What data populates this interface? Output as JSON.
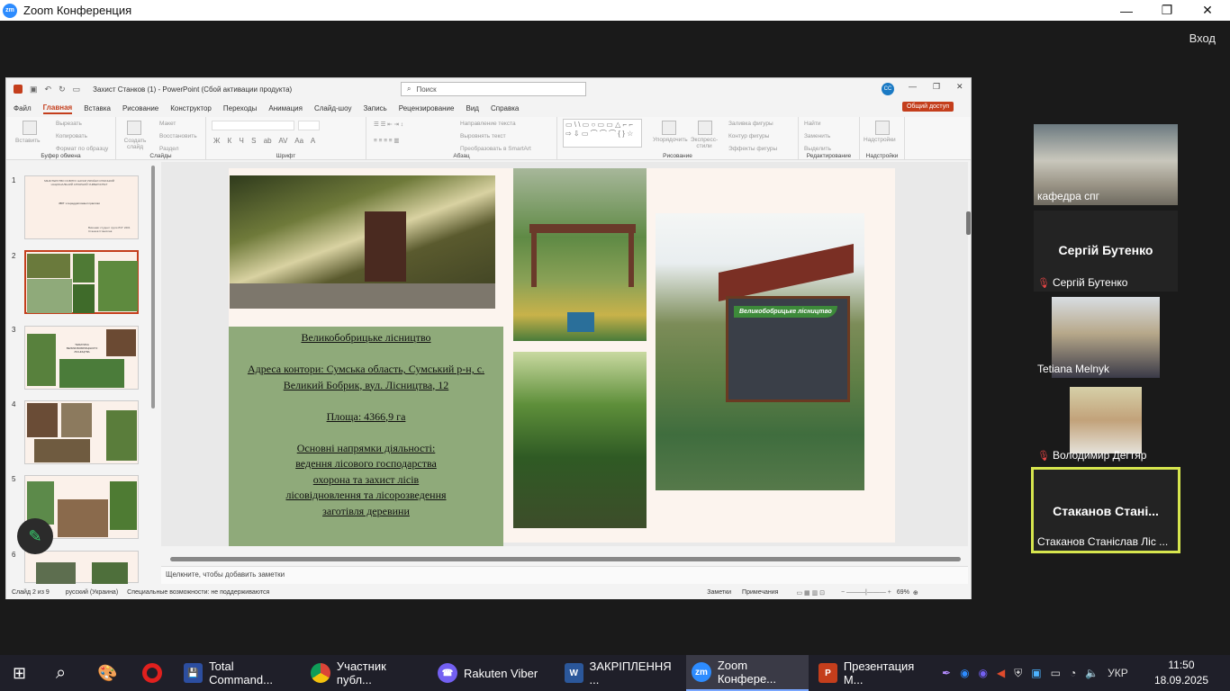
{
  "zoom": {
    "title": "Zoom Конференция",
    "login": "Вход",
    "logo": "zm"
  },
  "ppt": {
    "window_title": "Захист Станков (1)  -  PowerPoint (Сбой активации продукта)",
    "search": "Поиск",
    "user_initials": "CC",
    "tabs": [
      "Файл",
      "Главная",
      "Вставка",
      "Рисование",
      "Конструктор",
      "Переходы",
      "Анимация",
      "Слайд-шоу",
      "Запись",
      "Рецензирование",
      "Вид",
      "Справка"
    ],
    "share": "Общий доступ",
    "ribbon": {
      "clipboard": {
        "paste": "Вставить",
        "cut": "Вырезать",
        "copy": "Копировать",
        "format": "Формат по образцу",
        "label": "Буфер обмена"
      },
      "slides": {
        "new": "Создать слайд",
        "layout": "Макет",
        "reset": "Восстановить",
        "section": "Раздел",
        "label": "Слайды"
      },
      "font_label": "Шрифт",
      "font_buttons": [
        "Ж",
        "К",
        "Ч",
        "S",
        "ab",
        "AV",
        "Aa",
        "A"
      ],
      "para": {
        "dir": "Направление текста",
        "align": "Выровнять текст",
        "smartart": "Преобразовать в SmartArt",
        "label": "Абзац"
      },
      "drawing": {
        "arrange": "Упорядочить",
        "styles": "Экспресс-стили",
        "fill": "Заливка фигуры",
        "outline": "Контур фигуры",
        "effects": "Эффекты фигуры",
        "label": "Рисование"
      },
      "editing": {
        "find": "Найти",
        "replace": "Заменить",
        "select": "Выделить",
        "label": "Редактирование"
      },
      "addins": {
        "btn": "Надстройки",
        "label": "Надстройки"
      }
    },
    "slide_numbers": [
      "1",
      "2",
      "3",
      "4",
      "5",
      "6"
    ],
    "thumb1": {
      "top": "МІНІСТЕРСТВО ОСВІТИ І НАУКИ УКРАЇНИ СУМСЬКИЙ НАЦІОНАЛЬНИЙ АГРАРНИЙ УНІВЕРСИТЕТ",
      "mid": "ЗВІТ з переддипломної практики",
      "bottom": "Виконав: студент групи ЛСГ 2201 Станков Станіслав"
    },
    "thumb3_caption": "ТЕМАТИКА ВЕЛИКОБОБРИЦЬКОГО ЛІСНИЦТВА",
    "slide": {
      "lines": [
        {
          "t": "Великобобрицьке лісництво",
          "u": true
        },
        {
          "t": "",
          "u": false
        },
        {
          "t": "Адреса контори: Сумська область, Сумський р-н, с. Великий Бобрик, вул. Лісництва, 12",
          "u": true
        },
        {
          "t": "",
          "u": false
        },
        {
          "t": "Площа: 4366,9 га",
          "u": true
        },
        {
          "t": "",
          "u": false
        },
        {
          "t": "Основні напрямки діяльності:",
          "u": true
        },
        {
          "t": "ведення лісового господарства",
          "u": true
        },
        {
          "t": "охорона та захист лісів",
          "u": true
        },
        {
          "t": "лісовідновлення та лісорозведення",
          "u": true
        },
        {
          "t": "заготівля деревини",
          "u": true
        }
      ],
      "sign": "Великобобрицьке лісництво"
    },
    "notes": "Щелкните, чтобы добавить заметки",
    "status": {
      "slide": "Слайд 2 из 9",
      "lang": "русский (Украина)",
      "access": "Специальные возможности: не поддерживаются",
      "notes": "Заметки",
      "comments": "Примечания",
      "zoom": "69%"
    }
  },
  "participants": [
    {
      "name": "кафедра спг",
      "muted": false
    },
    {
      "name": "Сергій Бутенко",
      "big": "Сергій Бутенко",
      "muted": true
    },
    {
      "name": "Tetiana Melnyk",
      "muted": false
    },
    {
      "name": "Володимир Дегтяр",
      "muted": true
    },
    {
      "name": "Стаканов Станіслав Ліс ...",
      "big": "Стаканов  Стані...",
      "muted": false
    }
  ],
  "taskbar": {
    "apps": [
      "Total Command...",
      "Участник публ...",
      "Rakuten Viber",
      "ЗАКРІПЛЕННЯ ...",
      "Zoom Конфере...",
      "Презентация М..."
    ],
    "lang": "УКР",
    "time": "11:50",
    "date": "18.09.2025"
  },
  "colors": {
    "ppt_accent": "#c43e1c",
    "zoom_blue": "#2d8cff",
    "speaker_border": "#d7e64e",
    "textbox_green": "#8faa7a"
  }
}
